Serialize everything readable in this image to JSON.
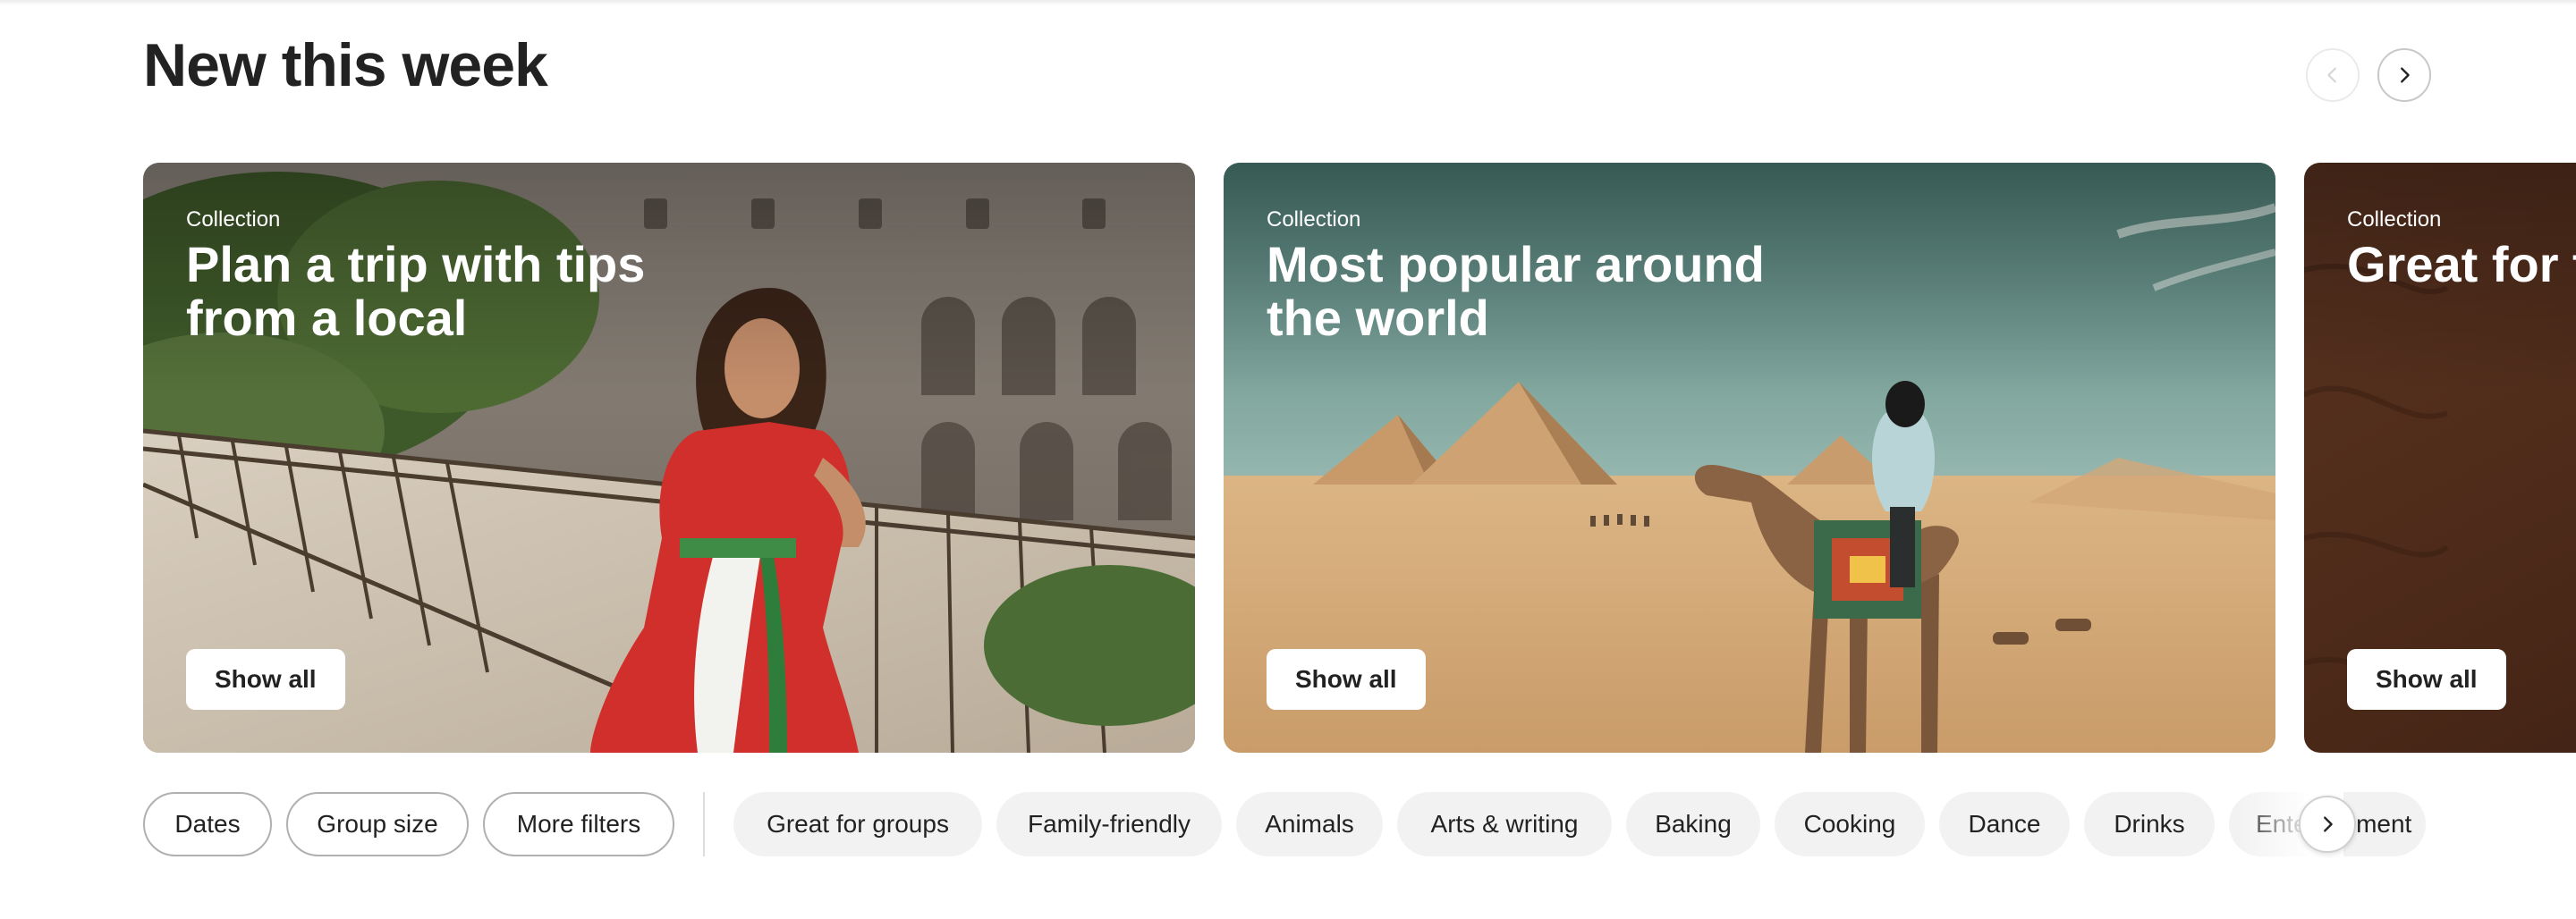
{
  "section": {
    "title": "New this week"
  },
  "carousel_nav": {
    "prev_icon": "chevron-left-icon",
    "next_icon": "chevron-right-icon"
  },
  "cards": [
    {
      "eyebrow": "Collection",
      "heading": "Plan a trip with tips from a local",
      "button": "Show all",
      "image": "woman-in-red-dress-at-colosseum"
    },
    {
      "eyebrow": "Collection",
      "heading": "Most popular around the world",
      "button": "Show all",
      "image": "camel-rider-at-pyramids"
    },
    {
      "eyebrow": "Collection",
      "heading": "Great for team building",
      "button": "Show all",
      "image": "dark-wood-texture"
    }
  ],
  "filters": {
    "outline": [
      "Dates",
      "Group size",
      "More filters"
    ],
    "categories": [
      "Great for groups",
      "Family-friendly",
      "Animals",
      "Arts & writing",
      "Baking",
      "Cooking",
      "Dance",
      "Drinks",
      "Entertainment"
    ],
    "scroll_icon": "chevron-right-icon"
  },
  "colors": {
    "text": "#222222",
    "chip_bg": "#f2f2f2",
    "outline": "#b0b0b0"
  }
}
